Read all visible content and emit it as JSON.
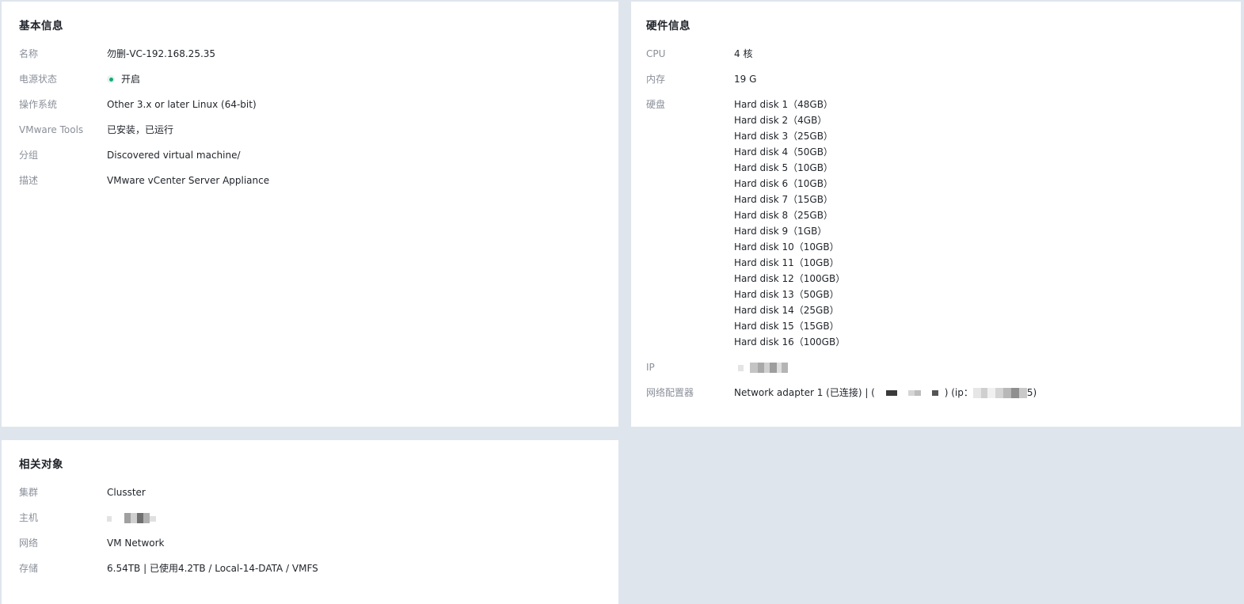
{
  "basic": {
    "title": "基本信息",
    "rows": [
      {
        "label": "名称",
        "value": "勿删-VC-192.168.25.35"
      },
      {
        "label": "电源状态",
        "value": "开启",
        "status_color": "#1aa676"
      },
      {
        "label": "操作系统",
        "value": "Other 3.x or later Linux (64-bit)"
      },
      {
        "label": "VMware Tools",
        "value": "已安装，已运行"
      },
      {
        "label": "分组",
        "value": "Discovered virtual machine/"
      },
      {
        "label": "描述",
        "value": "VMware vCenter Server Appliance"
      }
    ]
  },
  "hardware": {
    "title": "硬件信息",
    "cpu_label": "CPU",
    "cpu_value": "4 核",
    "memory_label": "内存",
    "memory_value": "19 G",
    "disk_label": "硬盘",
    "disks": [
      "Hard disk 1（48GB）",
      "Hard disk 2（4GB）",
      "Hard disk 3（25GB）",
      "Hard disk 4（50GB）",
      "Hard disk 5（10GB）",
      "Hard disk 6（10GB）",
      "Hard disk 7（15GB）",
      "Hard disk 8（25GB）",
      "Hard disk 9（1GB）",
      "Hard disk 10（10GB）",
      "Hard disk 11（10GB）",
      "Hard disk 12（100GB）",
      "Hard disk 13（50GB）",
      "Hard disk 14（25GB）",
      "Hard disk 15（15GB）",
      "Hard disk 16（100GB）"
    ],
    "ip_label": "IP",
    "nic_label": "网络配置器",
    "nic_prefix": "Network adapter 1 (已连接) | (",
    "nic_mid": ") (ip：",
    "nic_suffix": "5)"
  },
  "related": {
    "title": "相关对象",
    "rows": [
      {
        "label": "集群",
        "value": "Clusster"
      },
      {
        "label": "主机",
        "value": ""
      },
      {
        "label": "网络",
        "value": "VM Network"
      },
      {
        "label": "存储",
        "value": "6.54TB | 已使用4.2TB / Local-14-DATA / VMFS"
      }
    ]
  }
}
